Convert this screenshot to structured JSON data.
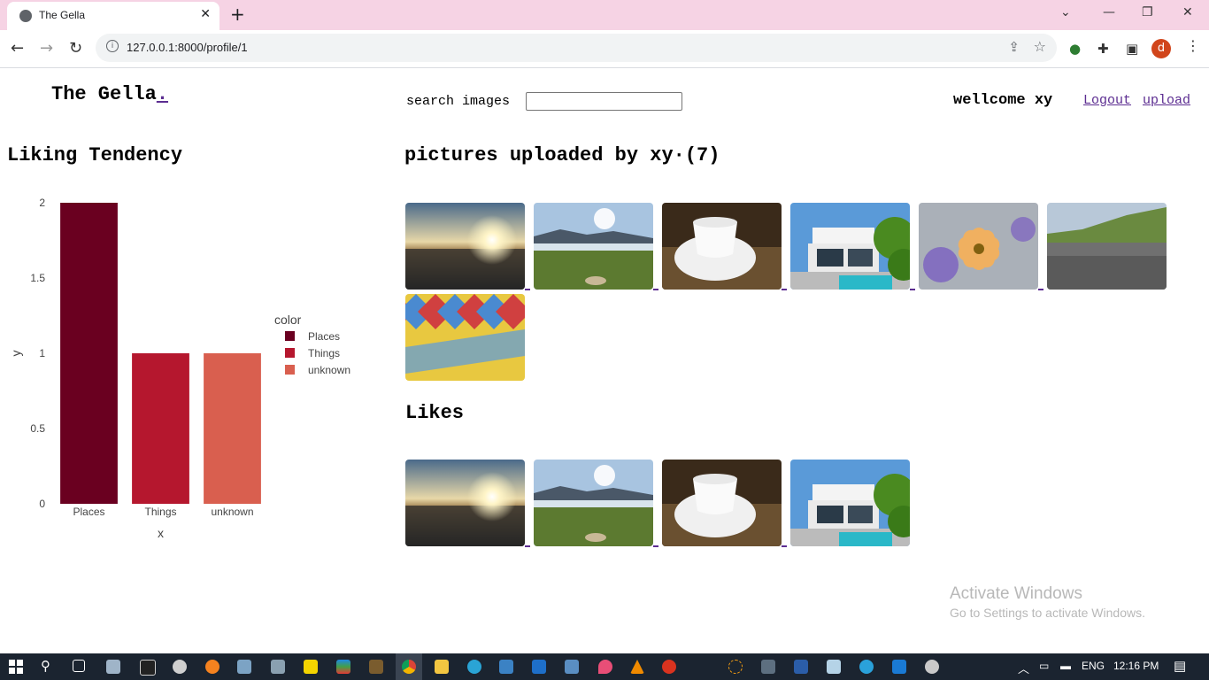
{
  "browser": {
    "tab_title": "The Gella",
    "url": "127.0.0.1:8000/profile/1",
    "profile_initial": "d"
  },
  "header": {
    "brand": "The Gella",
    "brand_dot": ".",
    "search_label": "search images",
    "welcome": "wellcome xy",
    "logout": "Logout",
    "upload": "upload"
  },
  "tendency": {
    "title": "Liking Tendency"
  },
  "chart_data": {
    "type": "bar",
    "categories": [
      "Places",
      "Things",
      "unknown"
    ],
    "values": [
      2,
      1,
      1
    ],
    "colors": [
      "#6a0020",
      "#b5172e",
      "#d95f4f"
    ],
    "xlabel": "x",
    "ylabel": "y",
    "ylim": [
      0,
      2
    ],
    "yticks": [
      "0",
      "0.5",
      "1",
      "1.5",
      "2"
    ],
    "legend_title": "color",
    "legend_position": "right",
    "grid": false
  },
  "uploads": {
    "title": "pictures uploaded by xy·(7)",
    "images": [
      {
        "subject": "sunset-sea"
      },
      {
        "subject": "lake-grass"
      },
      {
        "subject": "white-cup"
      },
      {
        "subject": "white-villa"
      },
      {
        "subject": "purple-flower"
      },
      {
        "subject": "gravel-hill"
      },
      {
        "subject": "woven-pattern"
      }
    ]
  },
  "likes": {
    "title": "Likes",
    "images": [
      {
        "subject": "sunset-sea"
      },
      {
        "subject": "lake-grass"
      },
      {
        "subject": "white-cup"
      },
      {
        "subject": "white-villa"
      }
    ]
  },
  "watermark": {
    "line1": "Activate Windows",
    "line2": "Go to Settings to activate Windows."
  },
  "taskbar": {
    "language": "ENG",
    "time": "12:16 PM"
  }
}
